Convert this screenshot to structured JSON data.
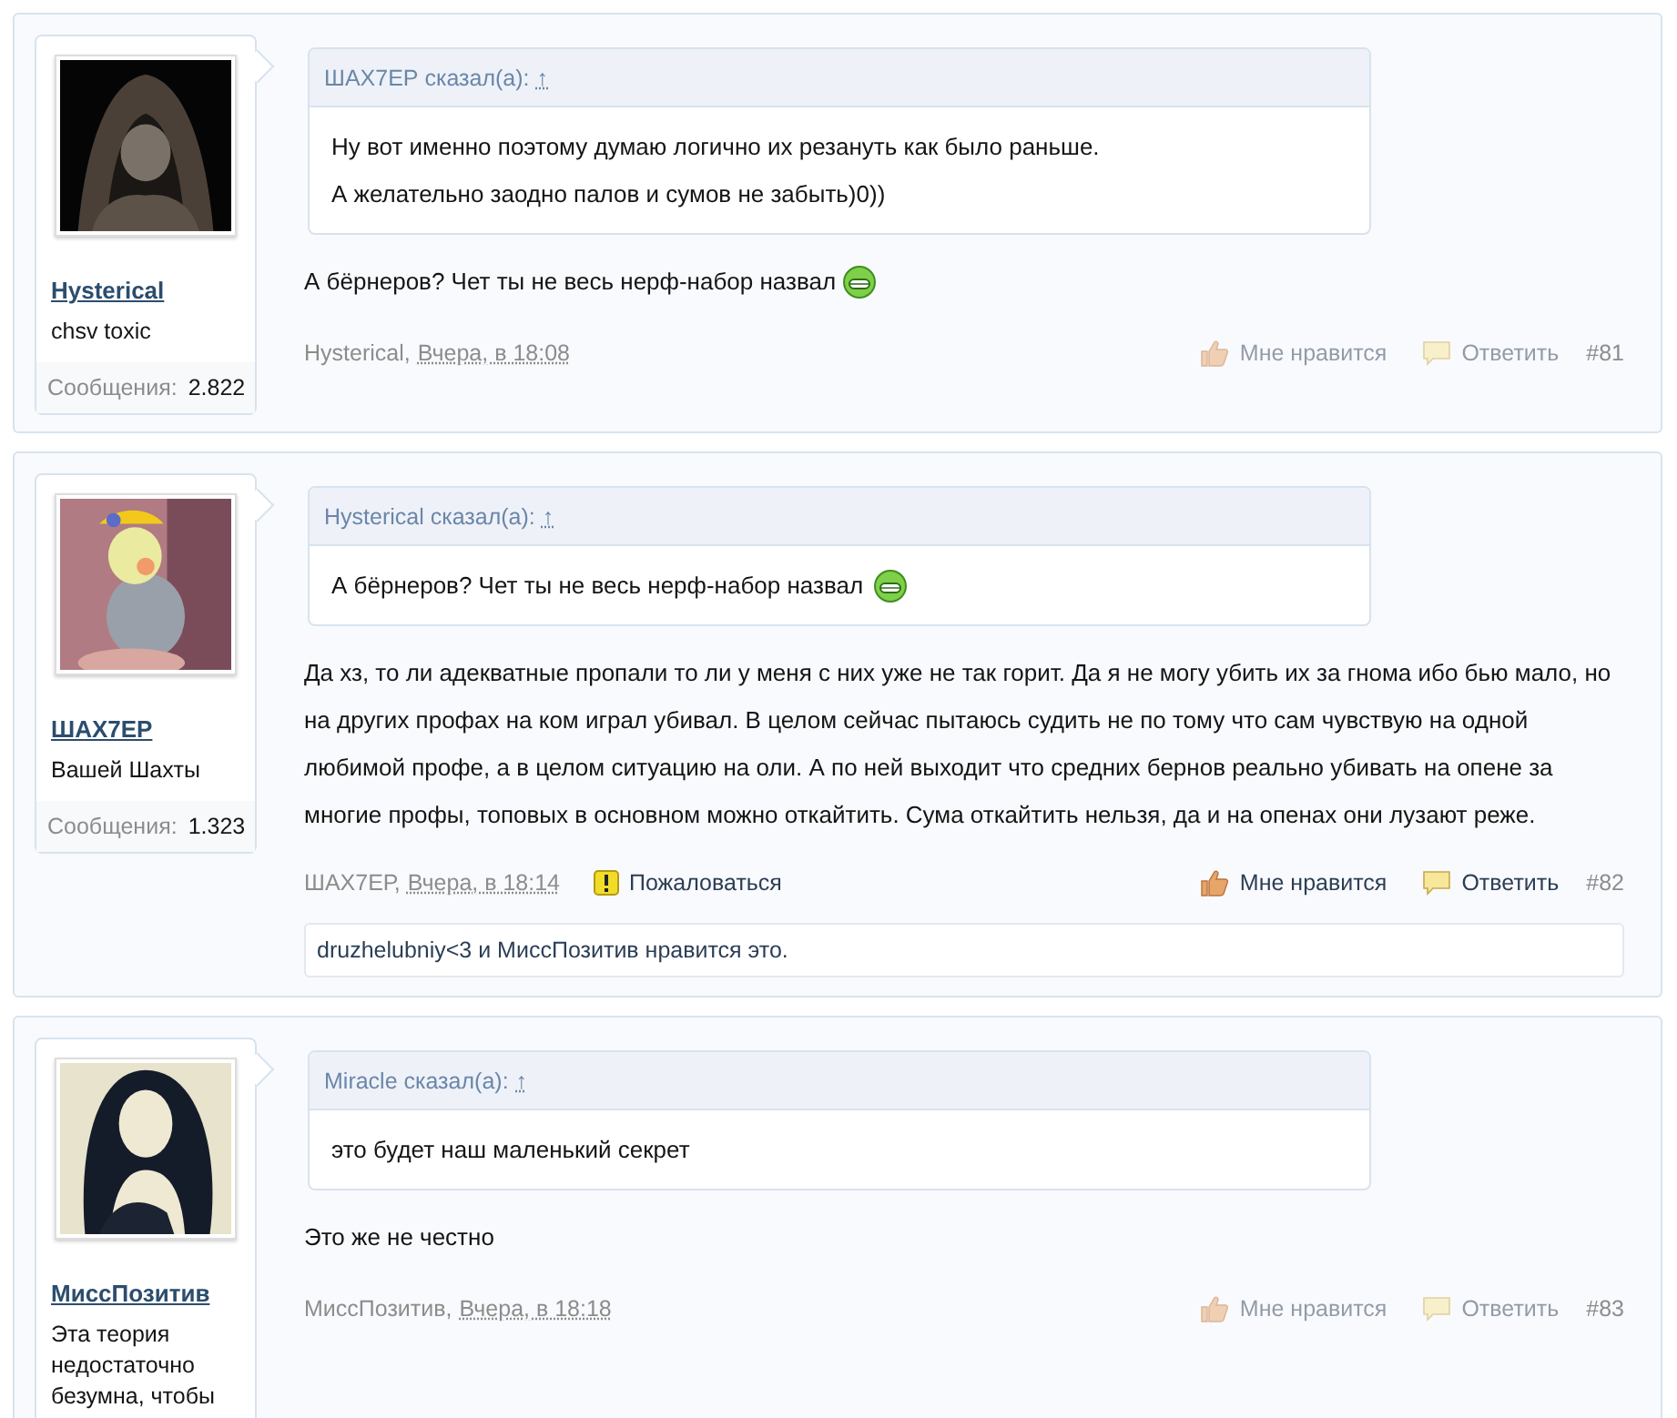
{
  "posts": [
    {
      "user": {
        "name": "Hysterical",
        "title": "chsv toxic",
        "stats_label": "Сообщения:",
        "stats_value": "2.822"
      },
      "quote": {
        "author": "ШАХ7ЕР сказал(а):",
        "jump": "↑",
        "lines": [
          "Ну вот именно поэтому думаю логично их резануть как было раньше.",
          "А желательно заодно палов и сумов не забыть)0))"
        ]
      },
      "message": {
        "text": "А бёрнеров? Чет ты не весь нерф-набор назвал",
        "emoji": true
      },
      "meta": {
        "author": "Hysterical,",
        "date": "Вчера, в 18:08"
      },
      "actions": {
        "like": "Мне нравится",
        "reply": "Ответить",
        "hovered": false
      },
      "number": "#81"
    },
    {
      "user": {
        "name": "ШАХ7ЕР",
        "title": "Вашей Шахты",
        "stats_label": "Сообщения:",
        "stats_value": "1.323"
      },
      "quote": {
        "author": "Hysterical сказал(а):",
        "jump": "↑",
        "lines": [
          "А бёрнеров? Чет ты не весь нерф-набор назвал"
        ],
        "emoji": true
      },
      "message": {
        "text": "Да хз, то ли адекватные пропали то ли у меня с них уже не так горит. Да я не могу убить их за гнома ибо бью мало, но на других профах на ком играл убивал. В целом сейчас пытаюсь судить не по тому что сам чувствую на одной любимой профе, а в целом ситуацию на оли. А по ней выходит что средних бернов реально убивать на опене за многие профы, топовых в основном можно откайтить. Сума откайтить нельзя, да и на опенах они лузают реже.",
        "emoji": false
      },
      "meta": {
        "author": "ШАХ7ЕР,",
        "date": "Вчера, в 18:14"
      },
      "report": "Пожаловаться",
      "actions": {
        "like": "Мне нравится",
        "reply": "Ответить",
        "hovered": true
      },
      "number": "#82",
      "likes": "druzhelubniy<3 и МиссПозитив нравится это."
    },
    {
      "user": {
        "name": "МиссПозитив",
        "title": "Эта теория недостаточно безумна, чтобы"
      },
      "quote": {
        "author": "Miracle сказал(а):",
        "jump": "↑",
        "lines": [
          "это будет наш маленький секрет"
        ]
      },
      "message": {
        "text": "Это же не честно",
        "emoji": false
      },
      "meta": {
        "author": "МиссПозитив,",
        "date": "Вчера, в 18:18"
      },
      "actions": {
        "like": "Мне нравится",
        "reply": "Ответить",
        "hovered": false
      },
      "number": "#83"
    }
  ]
}
